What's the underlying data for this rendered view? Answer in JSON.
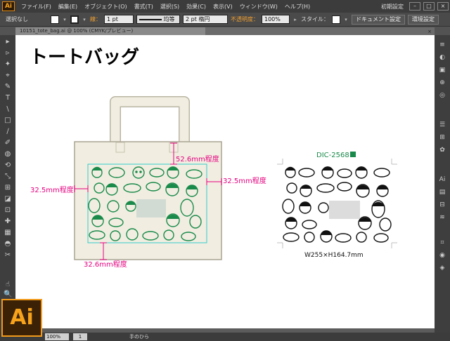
{
  "app": {
    "logo": "Ai"
  },
  "menu": {
    "items": [
      "ファイル(F)",
      "編集(E)",
      "オブジェクト(O)",
      "書式(T)",
      "選択(S)",
      "効果(C)",
      "表示(V)",
      "ウィンドウ(W)",
      "ヘルプ(H)"
    ],
    "workspace": "初期設定",
    "window_buttons": [
      "–",
      "□",
      "×"
    ]
  },
  "control": {
    "selection": "選択なし",
    "stroke_label": "線：",
    "stroke_value": "1 pt",
    "line_label": "均等",
    "brush_value": "2 pt 楕円",
    "opacity_label": "不透明度：",
    "opacity_value": "100%",
    "style_label": "スタイル：",
    "doc_settings": "ドキュメント設定",
    "prefs": "環境設定"
  },
  "document_tab": {
    "name": "10151_tote_bag.ai @ 100% (CMYK/プレビュー)",
    "close": "×"
  },
  "toolbar": {
    "icons": [
      "▸",
      "▹",
      "✦",
      "⌖",
      "✎",
      "T",
      "\\",
      "□",
      "∕",
      "✐",
      "◍",
      "⟲",
      "⤡",
      "⊞",
      "◪",
      "⊡",
      "✚",
      "▦",
      "◓",
      "✂",
      "☝",
      "🔍"
    ]
  },
  "rightpanel": {
    "icons": [
      "≡",
      "◐",
      "▣",
      "⊕",
      "◎",
      "☰",
      "⊞",
      "✿",
      "Ai",
      "▤",
      "⊟",
      "≋",
      "⌗",
      "◉",
      "◈"
    ]
  },
  "canvas": {
    "title": "トートバッグ",
    "dim_top": "52.6mm程度",
    "dim_left": "32.5mm程度",
    "dim_right": "32.5mm程度",
    "dim_bottom": "32.6mm程度",
    "product_code": "DIC-2568",
    "size_label": "W255×H164.7mm"
  },
  "status": {
    "zoom": "100%",
    "tool": "手のひら",
    "page": "1"
  },
  "colors": {
    "accent_pink": "#e5007f",
    "ink_green": "#1a8a4a",
    "bag": "#f1eee1",
    "guide_cyan": "#33cccc"
  }
}
